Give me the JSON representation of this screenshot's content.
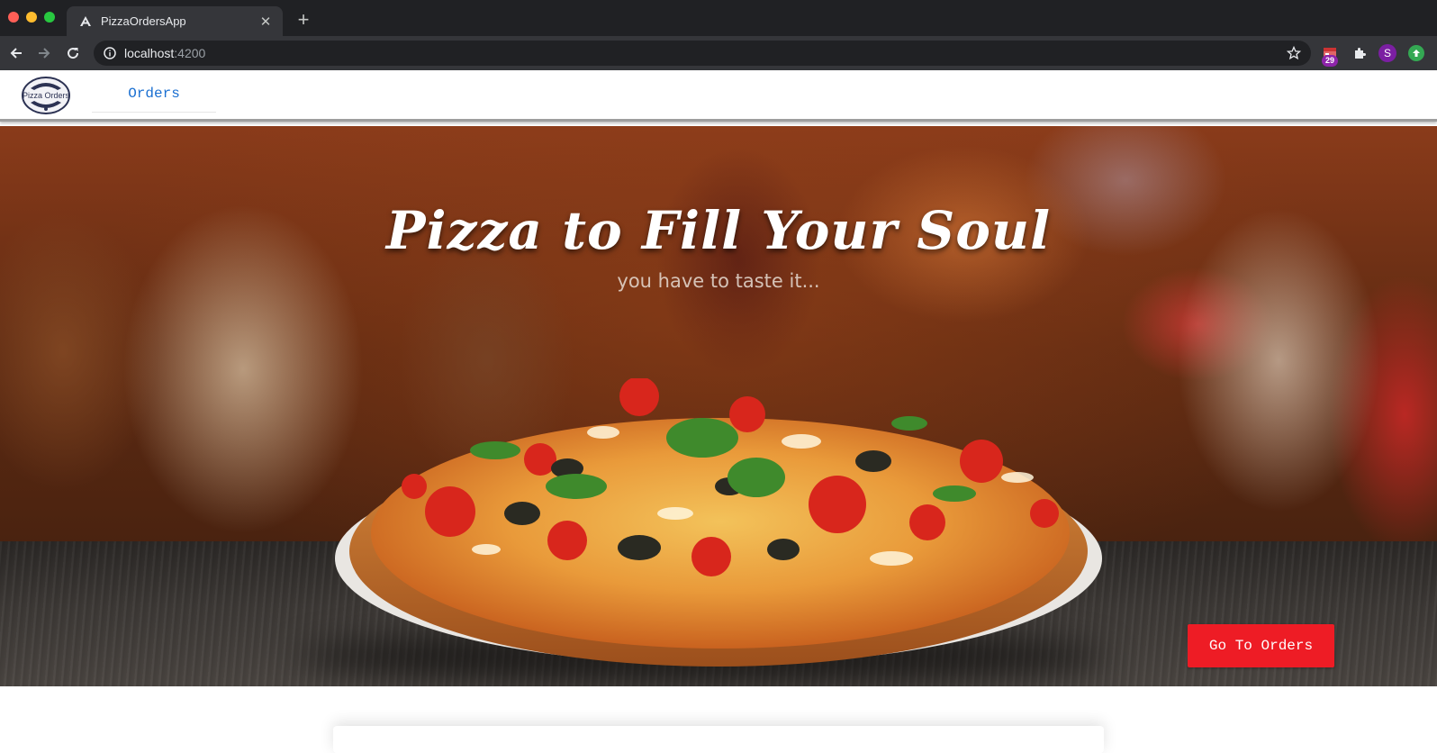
{
  "browser": {
    "tab_title": "PizzaOrdersApp",
    "url_host": "localhost",
    "url_port": ":4200",
    "extension_badge": "29",
    "profile_initial": "S"
  },
  "nav": {
    "logo_text": "Pizza Orders",
    "orders_link": "Orders"
  },
  "hero": {
    "headline": "Pizza to Fill Your Soul",
    "subline": "you have to taste it...",
    "cta_label": "Go To Orders"
  },
  "colors": {
    "cta": "#ee1c25",
    "nav_link": "#1a6fd1",
    "chrome_dark": "#202124"
  }
}
